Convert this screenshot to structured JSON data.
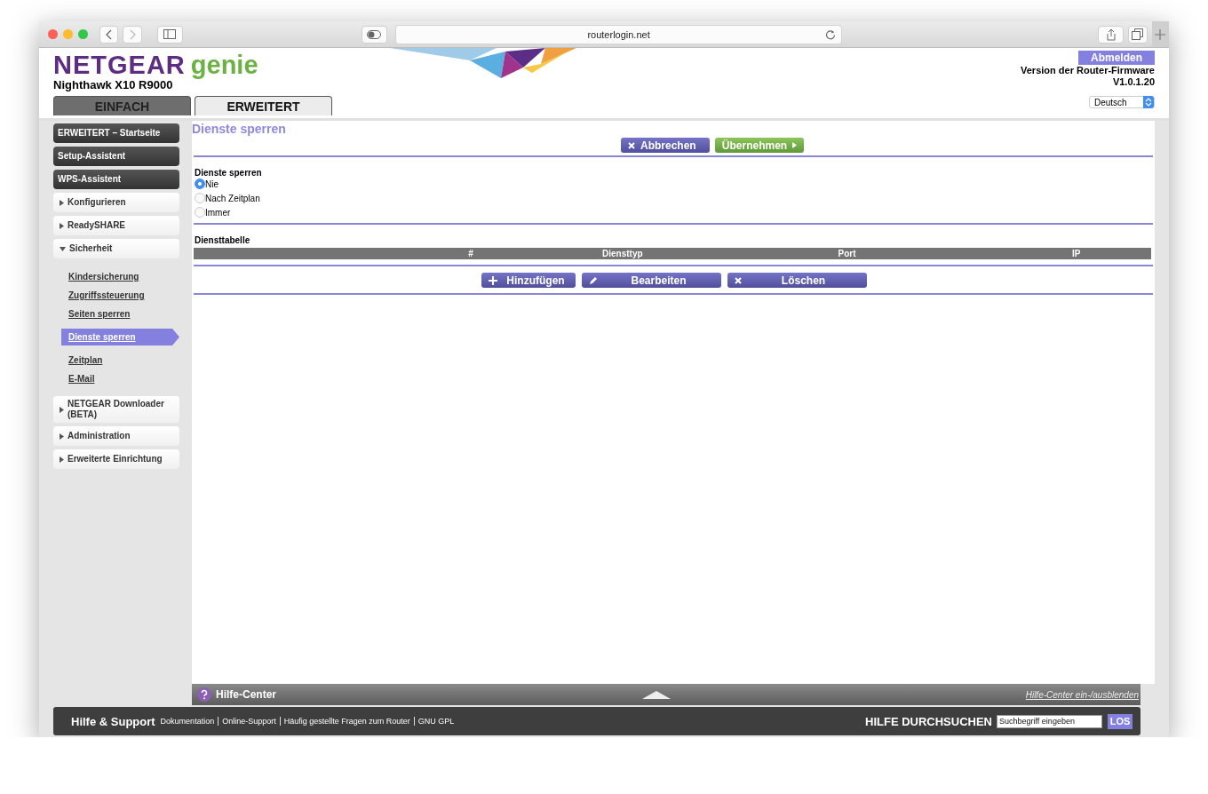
{
  "browser": {
    "url": "routerlogin.net"
  },
  "header": {
    "brand": "NETGEAR",
    "product": "genie",
    "model": "Nighthawk X10 R9000",
    "logout": "Abmelden",
    "firmware_label": "Version der Router-Firmware",
    "firmware_version": "V1.0.1.20",
    "language": "Deutsch"
  },
  "tabs": [
    {
      "label": "EINFACH",
      "selected": false
    },
    {
      "label": "ERWEITERT",
      "selected": true
    }
  ],
  "sidebar": {
    "items": [
      {
        "label": "ERWEITERT – Startseite",
        "kind": "button"
      },
      {
        "label": "Setup-Assistent",
        "kind": "button"
      },
      {
        "label": "WPS-Assistent",
        "kind": "button"
      },
      {
        "label": "Konfigurieren",
        "kind": "section",
        "expanded": false
      },
      {
        "label": "ReadySHARE",
        "kind": "section",
        "expanded": false
      },
      {
        "label": "Sicherheit",
        "kind": "section",
        "expanded": true,
        "children": [
          {
            "label": "Kindersicherung",
            "selected": false
          },
          {
            "label": "Zugriffssteuerung",
            "selected": false
          },
          {
            "label": "Seiten sperren",
            "selected": false
          },
          {
            "label": "Dienste sperren",
            "selected": true
          },
          {
            "label": "Zeitplan",
            "selected": false
          },
          {
            "label": "E-Mail",
            "selected": false
          }
        ]
      },
      {
        "label": "NETGEAR Downloader (BETA)",
        "kind": "section",
        "expanded": false
      },
      {
        "label": "Administration",
        "kind": "section",
        "expanded": false
      },
      {
        "label": "Erweiterte Einrichtung",
        "kind": "section",
        "expanded": false
      }
    ]
  },
  "content": {
    "title": "Dienste sperren",
    "buttons": [
      {
        "label": "Abbrechen",
        "kind": "cancel"
      },
      {
        "label": "Übernehmen",
        "kind": "apply"
      }
    ],
    "form": {
      "label": "Dienste sperren",
      "options": [
        {
          "label": "Nie",
          "selected": true
        },
        {
          "label": "Nach Zeitplan",
          "selected": false
        },
        {
          "label": "Immer",
          "selected": false
        }
      ]
    },
    "table": {
      "title": "Diensttabelle",
      "columns": [
        "#",
        "Diensttyp",
        "Port",
        "IP"
      ]
    },
    "table_buttons": [
      {
        "label": "Hinzufügen",
        "kind": "add"
      },
      {
        "label": "Bearbeiten",
        "kind": "edit"
      },
      {
        "label": "Löschen",
        "kind": "delete"
      }
    ]
  },
  "help_center": {
    "title": "Hilfe-Center",
    "toggle": "Hilfe-Center ein-/ausblenden"
  },
  "footer": {
    "title": "Hilfe & Support",
    "links": [
      "Dokumentation",
      "Online-Support",
      "Häufig gestellte Fragen zum Router",
      "GNU GPL"
    ],
    "search": {
      "label": "HILFE DURCHSUCHEN",
      "placeholder": "Suchbegriff eingeben",
      "button": "LOS"
    }
  }
}
